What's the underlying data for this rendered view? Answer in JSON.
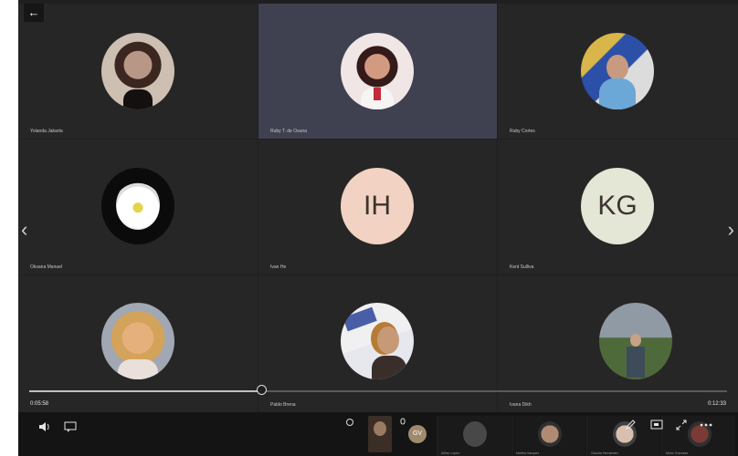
{
  "nav": {
    "back": "←",
    "prev": "‹",
    "next": "›"
  },
  "tiles": [
    {
      "name": "Yolanda Jakarta",
      "type": "photo"
    },
    {
      "name": "Ruby T. de Osuna",
      "type": "photo"
    },
    {
      "name": "Ruby Cortes",
      "type": "photo"
    },
    {
      "name": "Oksana Manuel",
      "type": "photo"
    },
    {
      "name": "Ivan He",
      "type": "initials",
      "initials": "IH",
      "color": "#f2d2c2"
    },
    {
      "name": "Kent Sulliva",
      "type": "initials",
      "initials": "KG",
      "color": "#e4e6d6"
    },
    {
      "name": "",
      "type": "photo"
    },
    {
      "name": "Pablo Brena",
      "type": "photo"
    },
    {
      "name": "Ivana Dikh",
      "type": "photo"
    }
  ],
  "player": {
    "elapsed": "0:05:58",
    "total": "0:12:33",
    "progress_percent": 33.4
  },
  "controls": {
    "speaker_icon": "speaker-icon",
    "captions_icon": "captions-icon",
    "gv_badge": "GV"
  },
  "strip": [
    {
      "label": "Arthur Lopez"
    },
    {
      "label": "Martha Vazquez"
    },
    {
      "label": "Claudia Hernandez"
    },
    {
      "label": "Mario Gonzalez"
    }
  ]
}
